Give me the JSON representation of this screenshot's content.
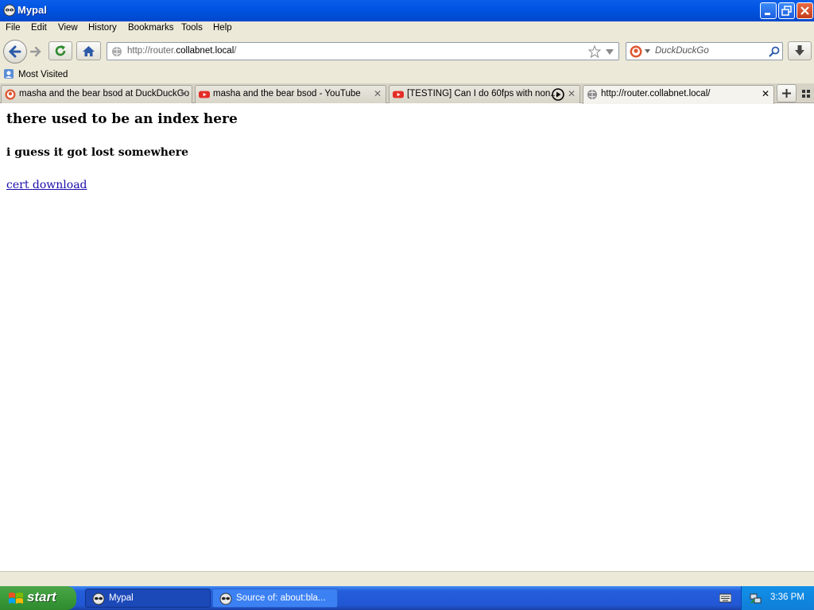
{
  "window": {
    "title": "Mypal"
  },
  "menubar": {
    "items": [
      "File",
      "Edit",
      "View",
      "History",
      "Bookmarks",
      "Tools",
      "Help"
    ]
  },
  "navbar": {
    "url_prefix": "http://router.",
    "url_host": "collabnet.local",
    "url_suffix": "/",
    "search_placeholder": "DuckDuckGo"
  },
  "bookmarks": {
    "most_visited": "Most Visited"
  },
  "tabs": [
    {
      "label": "masha and the bear bsod at DuckDuckGo",
      "favicon": "duckduckgo-icon",
      "selected": false
    },
    {
      "label": "masha and the bear bsod - YouTube",
      "favicon": "youtube-icon",
      "selected": false
    },
    {
      "label": "[TESTING] Can I do 60fps with non...",
      "favicon": "youtube-icon",
      "selected": false,
      "playing": true
    },
    {
      "label": "http://router.collabnet.local/",
      "favicon": "globe-icon",
      "selected": true
    }
  ],
  "page": {
    "heading": "there used to be an index here",
    "subheading": "i guess it got lost somewhere",
    "link": "cert download"
  },
  "taskbar": {
    "start_label": "start",
    "tasks": [
      {
        "label": "Mypal",
        "active": true
      },
      {
        "label": "Source of: about:bla...",
        "active": false
      }
    ],
    "clock": "3:36 PM"
  },
  "colors": {
    "titlebar": "#0054e3",
    "chrome": "#ece9d8",
    "taskbar": "#245edb",
    "start": "#3b9a3a",
    "link": "#1a0dab"
  }
}
